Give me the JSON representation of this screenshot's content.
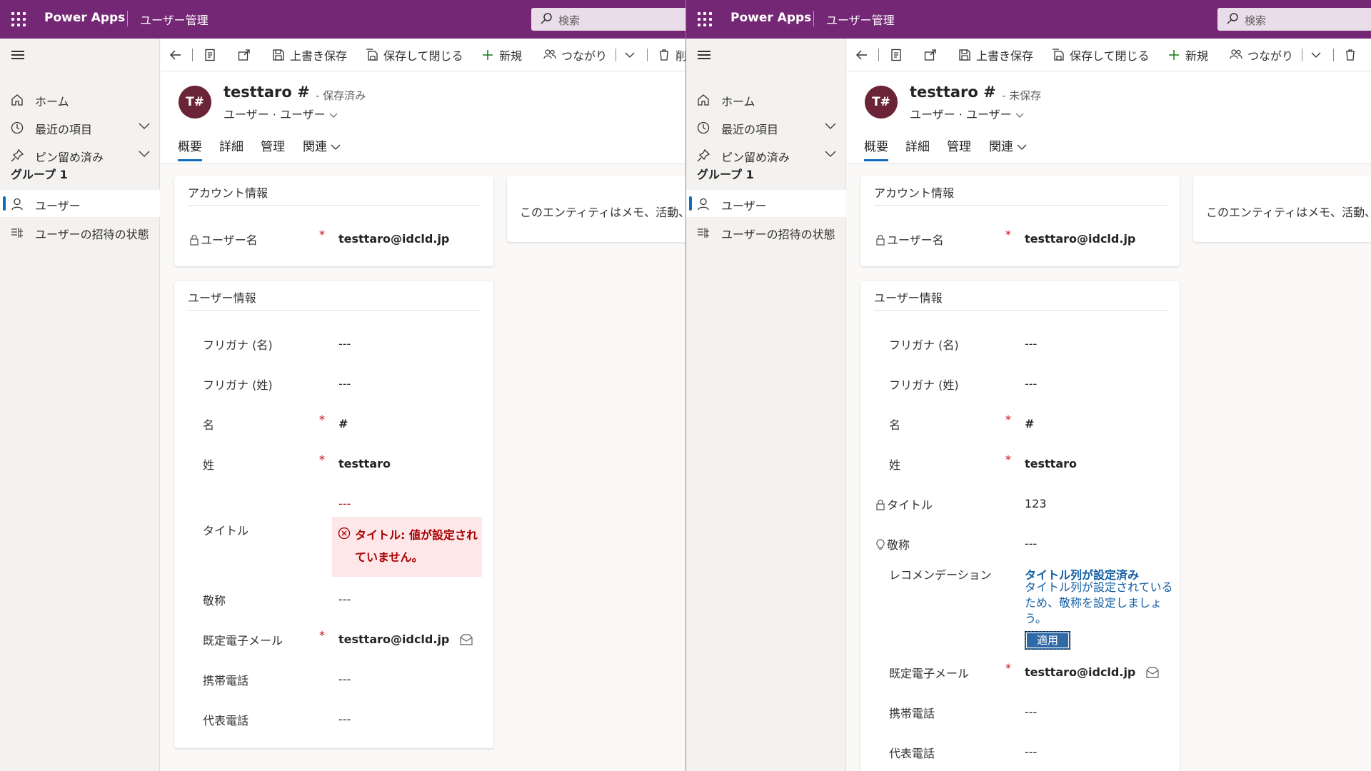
{
  "app": {
    "name": "Power Apps",
    "page": "ユーザー管理",
    "search_placeholder": "検索"
  },
  "sidebar": {
    "home": "ホーム",
    "recent": "最近の項目",
    "pinned": "ピン留め済み",
    "group": "グループ 1",
    "users": "ユーザー",
    "invitations": "ユーザーの招待の状態"
  },
  "commands": {
    "save": "上書き保存",
    "save_close": "保存して閉じる",
    "new": "新規",
    "connect": "つながり",
    "delete_truncated": "削"
  },
  "record": {
    "avatar": "T#",
    "title": "testtaro #",
    "entity": "ユーザー · ユーザー",
    "tabs": [
      "概要",
      "詳細",
      "管理",
      "関連"
    ]
  },
  "sections": {
    "account": "アカウント情報",
    "user": "ユーザー情報",
    "note": "このエンティティはメモ、活動、"
  },
  "fields": {
    "username_label": "ユーザー名",
    "username_value": "testtaro@idcld.jp",
    "furigana_first": "フリガナ (名)",
    "furigana_last": "フリガナ (姓)",
    "first_name": "名",
    "first_name_value": "#",
    "last_name": "姓",
    "last_name_value": "testtaro",
    "job_title": "タイトル",
    "salutation": "敬称",
    "email": "既定電子メール",
    "email_value": "testtaro@idcld.jp",
    "mobile": "携帯電話",
    "main_phone": "代表電話",
    "empty": "---",
    "required_mark": "*"
  },
  "panel_left": {
    "status": "- 保存済み",
    "title_error": "タイトル: 値が設定されていません。"
  },
  "panel_right": {
    "status": "- 未保存",
    "job_title_value": "123",
    "recommendation_label": "レコメンデーション",
    "recommendation_title": "タイトル列が設定済み",
    "recommendation_body": "タイトル列が設定されているため、敬称を設定しましょう。",
    "apply": "適用"
  },
  "colors": {
    "topbar": "#742774",
    "accent": "#0f6cbd",
    "avatar": "#6b2337",
    "error": "#c50f1f",
    "error_bg": "#fde7e9",
    "recommendation": "#115ea3"
  }
}
